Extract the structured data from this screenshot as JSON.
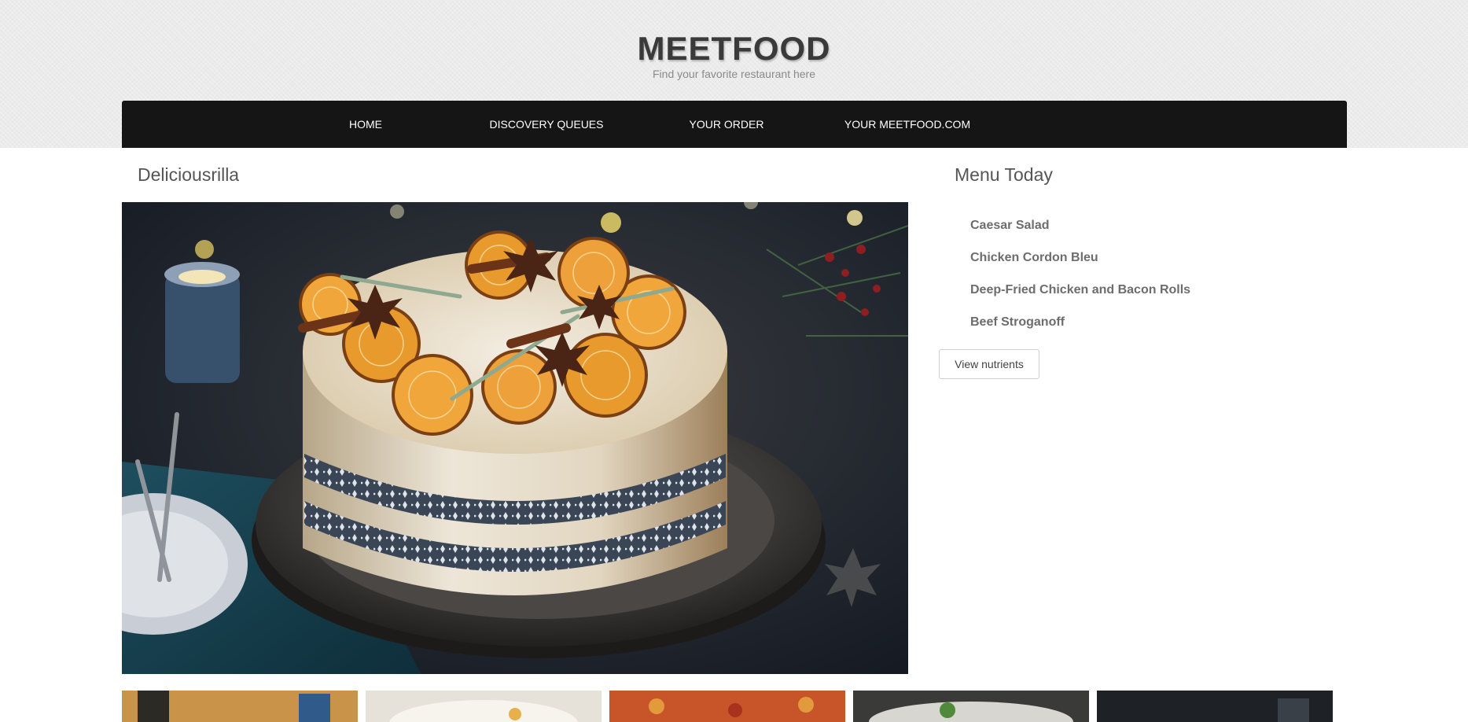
{
  "header": {
    "title": "MEETFOOD",
    "tagline": "Find your favorite restaurant here"
  },
  "nav": {
    "items": [
      {
        "label": "HOME"
      },
      {
        "label": "DISCOVERY QUEUES"
      },
      {
        "label": "YOUR ORDER"
      },
      {
        "label": "YOUR MEETFOOD.COM"
      }
    ]
  },
  "main": {
    "restaurant_name": "Deliciousrilla",
    "hero_image": "decorated-cake-photo"
  },
  "sidebar": {
    "heading": "Menu Today",
    "menu_items": [
      {
        "label": "Caesar Salad"
      },
      {
        "label": "Chicken Cordon Bleu"
      },
      {
        "label": "Deep-Fried Chicken and Bacon Rolls"
      },
      {
        "label": "Beef Stroganoff"
      }
    ],
    "button_label": "View nutrients"
  },
  "gallery": {
    "thumbnails": [
      "drinks-photo",
      "soup-bowl-photo",
      "pizza-photo",
      "plated-dish-photo",
      "dark-table-photo"
    ]
  },
  "colors": {
    "header_background": "#ebebeb",
    "navbar": "#151515",
    "nav_text": "#ffffff",
    "heading_text": "#555555"
  }
}
